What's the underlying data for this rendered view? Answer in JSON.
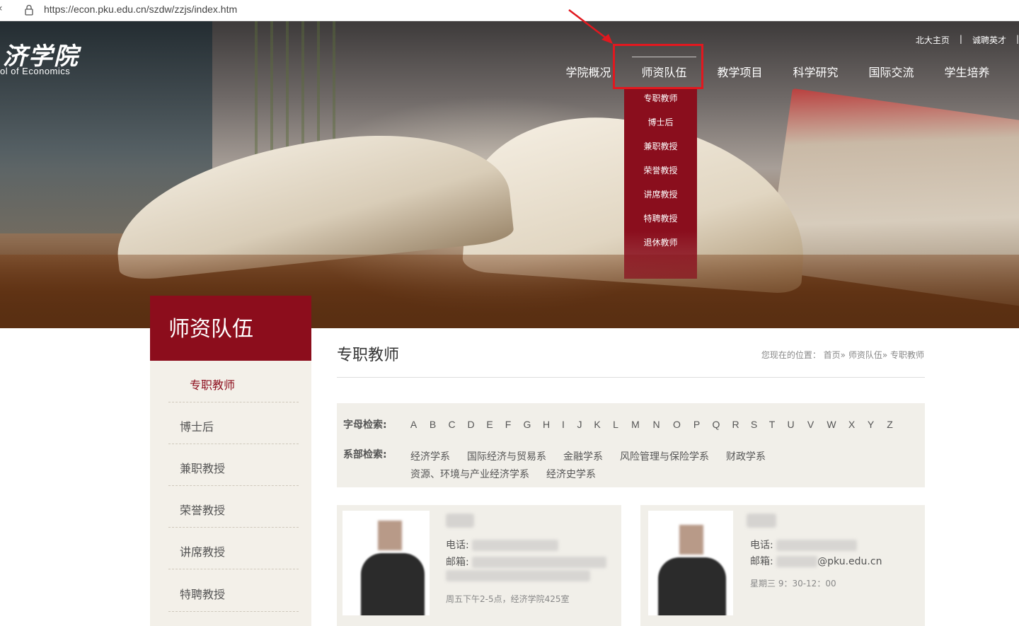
{
  "browser": {
    "url": "https://econ.pku.edu.cn/szdw/zzjs/index.htm"
  },
  "header": {
    "logo_cn": "济学院",
    "logo_en": "ol of Economics",
    "top_links": [
      "北大主页",
      "|",
      "诚聘英才",
      "|"
    ],
    "nav": [
      "学院概况",
      "师资队伍",
      "教学项目",
      "科学研究",
      "国际交流",
      "学生培养"
    ],
    "nav_active": "师资队伍",
    "dropdown": [
      "专职教师",
      "博士后",
      "兼职教授",
      "荣誉教授",
      "讲席教授",
      "特聘教授",
      "退休教师"
    ]
  },
  "sidebar": {
    "title": "师资队伍",
    "items": [
      "专职教师",
      "博士后",
      "兼职教授",
      "荣誉教授",
      "讲席教授",
      "特聘教授"
    ],
    "active": "专职教师"
  },
  "content": {
    "title": "专职教师",
    "breadcrumb": "您现在的位置： 首页» 师资队伍» 专职教师",
    "letter_label": "字母检索:",
    "letters": [
      "A",
      "B",
      "C",
      "D",
      "E",
      "F",
      "G",
      "H",
      "I",
      "J",
      "K",
      "L",
      "M",
      "N",
      "O",
      "P",
      "Q",
      "R",
      "S",
      "T",
      "U",
      "V",
      "W",
      "X",
      "Y",
      "Z"
    ],
    "dept_label": "系部检索:",
    "departments": [
      "经济学系",
      "国际经济与贸易系",
      "金融学系",
      "风险管理与保险学系",
      "财政学系",
      "资源、环境与产业经济学系",
      "经济史学系"
    ]
  },
  "cards": [
    {
      "phone_label": "电话:",
      "email_label": "邮箱:",
      "note": "周五下午2-5点，经济学院425室"
    },
    {
      "phone_label": "电话:",
      "email_label": "邮箱:",
      "email_suffix": "@pku.edu.cn",
      "note": "星期三 9：30-12：00"
    }
  ],
  "colors": {
    "brand": "#8c0d1c",
    "highlight": "#e1181f",
    "panel": "#f1efe9"
  }
}
